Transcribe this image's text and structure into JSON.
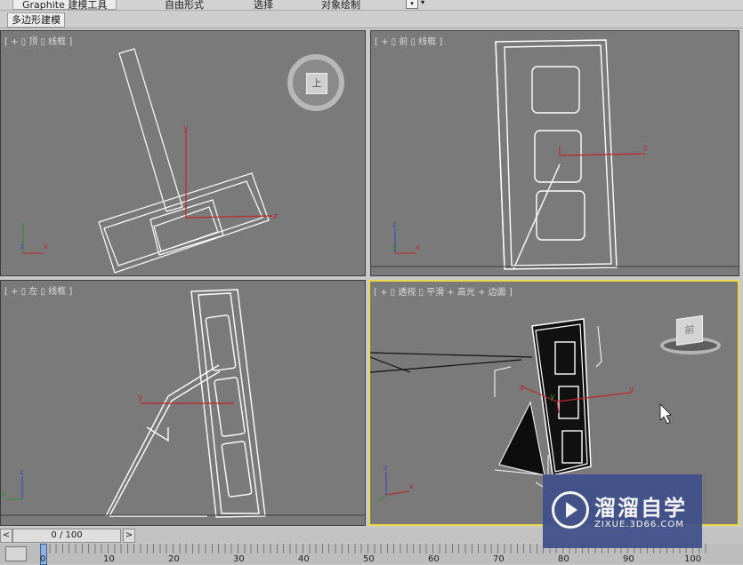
{
  "ribbon": {
    "tabs": [
      "Graphite 建模工具",
      "自由形式",
      "选择",
      "对象绘制"
    ],
    "dropdown_icon": "dropdown-icon"
  },
  "subbar": {
    "polygon_modeling": "多边形建模"
  },
  "viewports": {
    "top": {
      "label": "[ + ▯ 顶 ▯ 线框 ]",
      "cube_face": "上"
    },
    "front": {
      "label": "[ + ▯ 前 ▯ 线框 ]"
    },
    "left": {
      "label": "[ + ▯ 左 ▯ 线框 ]"
    },
    "persp": {
      "label": "[ + ▯ 透视 ▯ 平滑 + 高光 + 边面 ]",
      "cube_face": "前"
    }
  },
  "timeline": {
    "frame": "0 / 100",
    "prev_label": "<",
    "next_label": ">",
    "ticks": [
      "0",
      "10",
      "20",
      "30",
      "40",
      "50",
      "60",
      "70",
      "80",
      "90",
      "100"
    ]
  },
  "watermark": {
    "name": "溜溜自学",
    "url": "ZIXUE.3D66.COM"
  },
  "colors": {
    "viewport_bg": "#7a7a7a",
    "active_border": "#e8d84a",
    "gizmo": "#c0262a"
  }
}
